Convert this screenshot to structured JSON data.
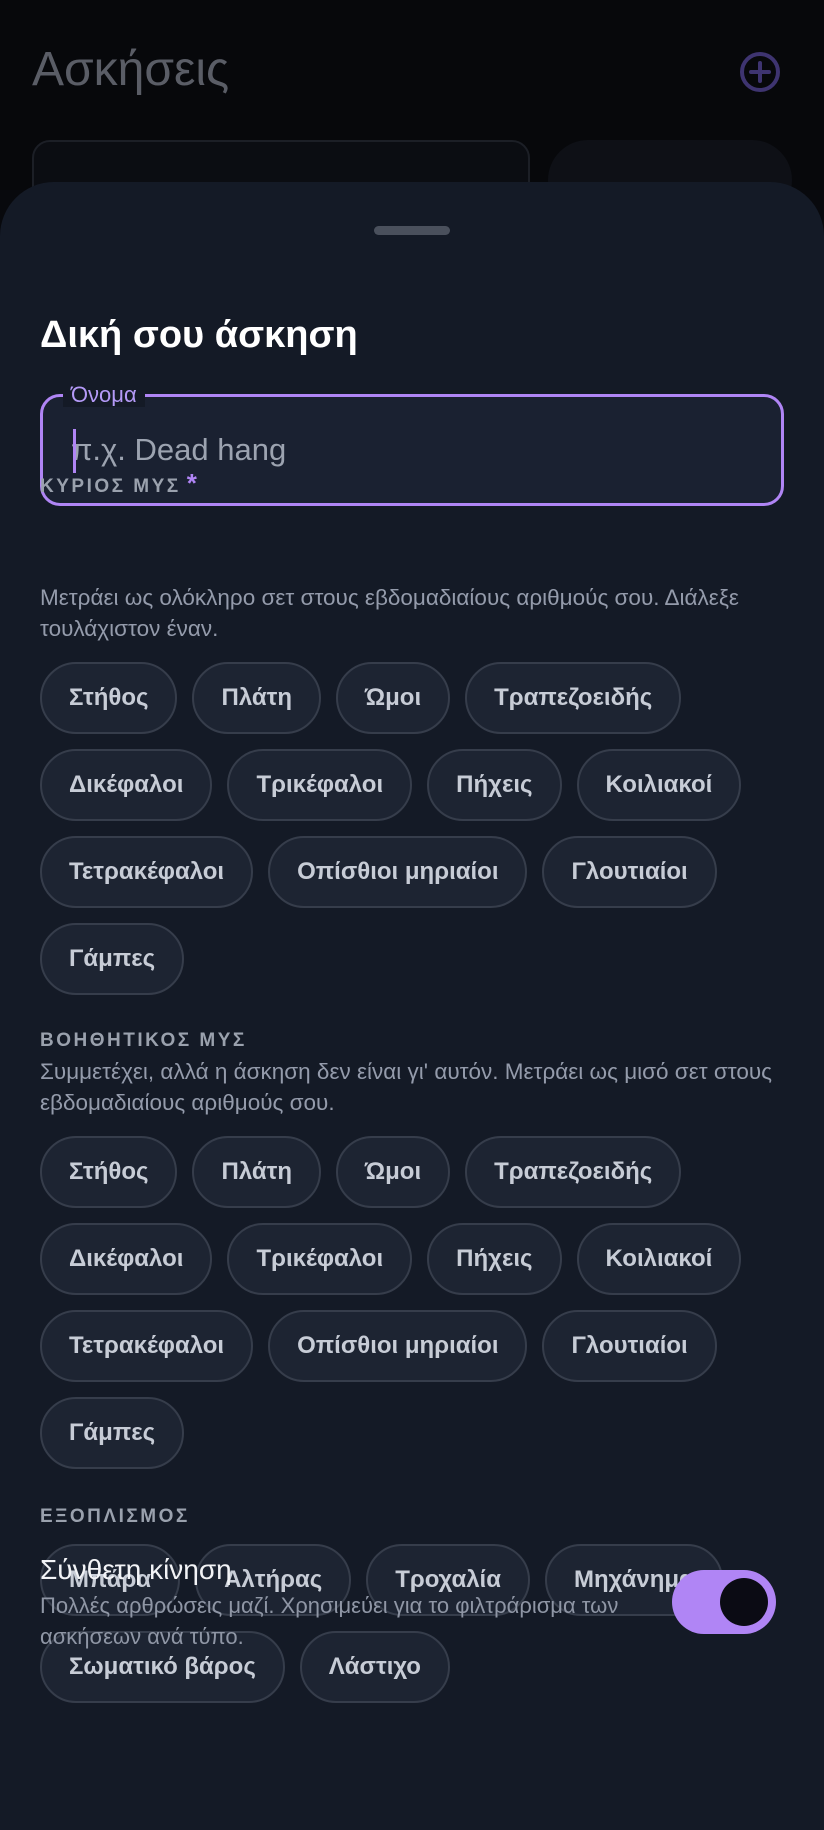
{
  "background": {
    "title": "Ασκήσεις",
    "add_icon": "plus-circle-icon"
  },
  "sheet": {
    "title": "Δική σου άσκηση",
    "name_field": {
      "label": "Όνομα",
      "placeholder": "π.χ. Dead hang",
      "value": ""
    },
    "primary_muscle": {
      "title": "ΚΥΡΙΟΣ ΜΥΣ",
      "required_mark": "*",
      "description": "Μετράει ως ολόκληρο σετ στους εβδομαδιαίους αριθμούς σου. Διάλεξε τουλάχιστον έναν.",
      "options": [
        "Στήθος",
        "Πλάτη",
        "Ώμοι",
        "Τραπεζοειδής",
        "Δικέφαλοι",
        "Τρικέφαλοι",
        "Πήχεις",
        "Κοιλιακοί",
        "Τετρακέφαλοι",
        "Οπίσθιοι μηριαίοι",
        "Γλουτιαίοι",
        "Γάμπες"
      ]
    },
    "secondary_muscle": {
      "title": "ΒΟΗΘΗΤΙΚΟΣ ΜΥΣ",
      "description": "Συμμετέχει, αλλά η άσκηση δεν είναι γι' αυτόν. Μετράει ως μισό σετ στους εβδομαδιαίους αριθμούς σου.",
      "options": [
        "Στήθος",
        "Πλάτη",
        "Ώμοι",
        "Τραπεζοειδής",
        "Δικέφαλοι",
        "Τρικέφαλοι",
        "Πήχεις",
        "Κοιλιακοί",
        "Τετρακέφαλοι",
        "Οπίσθιοι μηριαίοι",
        "Γλουτιαίοι",
        "Γάμπες"
      ]
    },
    "equipment": {
      "title": "ΕΞΟΠΛΙΣΜΟΣ",
      "options": [
        "Μπάρα",
        "Αλτήρας",
        "Τροχαλία",
        "Μηχάνημα",
        "Σωματικό βάρος",
        "Λάστιχο"
      ]
    },
    "compound": {
      "title": "Σύνθετη κίνηση",
      "description": "Πολλές αρθρώσεις μαζί. Χρησιμεύει για το φιλτράρισμα των ασκήσεων ανά τύπο.",
      "enabled": true
    }
  },
  "colors": {
    "accent": "#b085f5",
    "sheet_bg": "#141a26",
    "chip_bg": "#1d2432"
  }
}
